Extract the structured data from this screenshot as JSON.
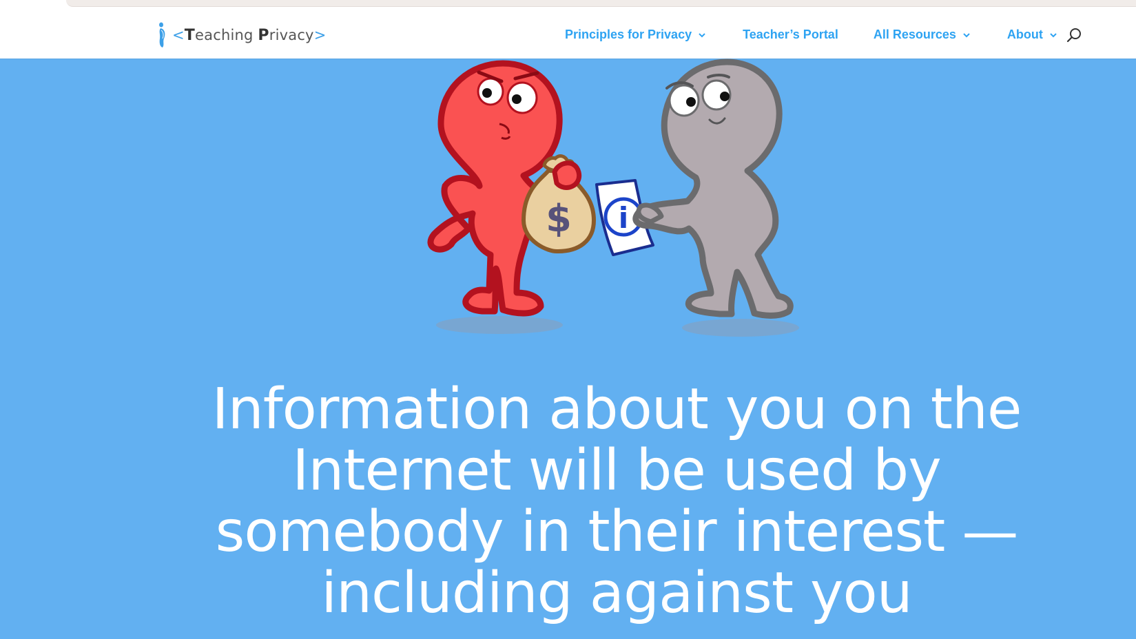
{
  "site": {
    "logo_open": "<",
    "logo_word1_cap": "T",
    "logo_word1_rest": "eaching ",
    "logo_word2_cap": "P",
    "logo_word2_rest": "rivacy",
    "logo_close": ">"
  },
  "nav": {
    "items": [
      {
        "label": "Principles for Privacy",
        "has_dropdown": true
      },
      {
        "label": "Teacher’s Portal",
        "has_dropdown": false
      },
      {
        "label": "All Resources",
        "has_dropdown": true
      },
      {
        "label": "About",
        "has_dropdown": true
      }
    ],
    "search_icon": "search-icon"
  },
  "hero": {
    "headline": "Information about you on the Internet will be used by somebody in their interest — including against you",
    "illustration_bag_symbol": "$",
    "illustration_paper_symbol": "i"
  },
  "colors": {
    "accent": "#2ea3f2",
    "hero_bg": "#62b0f1",
    "red_figure": "#fa5252",
    "gray_figure": "#b3aaaf"
  }
}
